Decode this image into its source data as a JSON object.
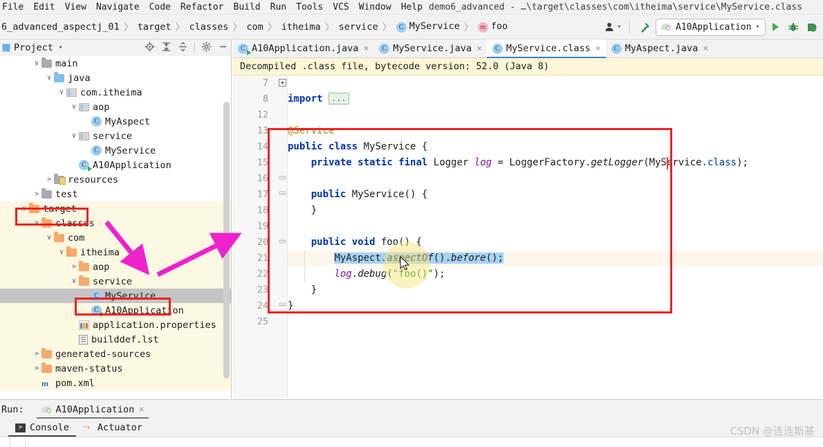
{
  "menu": {
    "items": [
      "File",
      "Edit",
      "View",
      "Navigate",
      "Code",
      "Refactor",
      "Build",
      "Run",
      "Tools",
      "VCS",
      "Window",
      "Help"
    ],
    "window_title": "demo6_advanced - …\\target\\classes\\com\\itheima\\service\\MyService.class"
  },
  "breadcrumb": {
    "items": [
      {
        "label": "6_advanced_aspectj_01",
        "icon": "none"
      },
      {
        "label": "target",
        "icon": "none"
      },
      {
        "label": "classes",
        "icon": "none"
      },
      {
        "label": "com",
        "icon": "none"
      },
      {
        "label": "itheima",
        "icon": "none"
      },
      {
        "label": "service",
        "icon": "none"
      },
      {
        "label": "MyService",
        "icon": "class-icon",
        "glyph": "C"
      },
      {
        "label": "foo",
        "icon": "method-icon",
        "glyph": "m"
      }
    ],
    "separator": "〉"
  },
  "toolbar": {
    "profile_icon": "user-silhouette-icon",
    "profile_caret": "▾",
    "build_icon": "hammer-icon",
    "run_config": {
      "label": "A10Application",
      "icon": "spring-boot-icon",
      "caret": "▾"
    },
    "run_icon": "run-play-icon",
    "debug_icon": "debug-bug-icon",
    "run_coverage_icon": "run-with-coverage-icon"
  },
  "sidebar": {
    "title": "Project",
    "title_caret": "▾",
    "header_icons": [
      "locate-target-icon",
      "expand-all-icon",
      "collapse-all-icon",
      "settings-gear-icon",
      "hide-minimize-icon"
    ],
    "tree": [
      {
        "label": "main",
        "depth": 2,
        "chev": "∨",
        "icon": "folder-gray",
        "highlight": "none",
        "selected": false
      },
      {
        "label": "java",
        "depth": 3,
        "chev": "∨",
        "icon": "folder-blue",
        "highlight": "none",
        "selected": false
      },
      {
        "label": "com.itheima",
        "depth": 4,
        "chev": "∨",
        "icon": "package",
        "highlight": "none",
        "selected": false
      },
      {
        "label": "aop",
        "depth": 5,
        "chev": "∨",
        "icon": "package",
        "highlight": "none",
        "selected": false
      },
      {
        "label": "MyAspect",
        "depth": 6,
        "chev": "",
        "icon": "class",
        "highlight": "none",
        "selected": false
      },
      {
        "label": "service",
        "depth": 5,
        "chev": "∨",
        "icon": "package",
        "highlight": "none",
        "selected": false
      },
      {
        "label": "MyService",
        "depth": 6,
        "chev": "",
        "icon": "class",
        "highlight": "none",
        "selected": false
      },
      {
        "label": "A10Application",
        "depth": 5,
        "chev": "",
        "icon": "class-run",
        "highlight": "none",
        "selected": false
      },
      {
        "label": "resources",
        "depth": 3,
        "chev": ">",
        "icon": "resource",
        "highlight": "none",
        "selected": false
      },
      {
        "label": "test",
        "depth": 2,
        "chev": ">",
        "icon": "folder-gray",
        "highlight": "none",
        "selected": false
      },
      {
        "label": "target",
        "depth": 1,
        "chev": "∨",
        "icon": "folder-orange",
        "highlight": "yellow",
        "selected": false
      },
      {
        "label": "classes",
        "depth": 2,
        "chev": "∨",
        "icon": "folder-orange",
        "highlight": "yellow",
        "selected": false
      },
      {
        "label": "com",
        "depth": 3,
        "chev": "∨",
        "icon": "folder-orange",
        "highlight": "yellow",
        "selected": false
      },
      {
        "label": "itheima",
        "depth": 4,
        "chev": "∨",
        "icon": "folder-orange",
        "highlight": "yellow",
        "selected": false
      },
      {
        "label": "aop",
        "depth": 5,
        "chev": ">",
        "icon": "folder-orange",
        "highlight": "yellow",
        "selected": false
      },
      {
        "label": "service",
        "depth": 5,
        "chev": "∨",
        "icon": "folder-orange",
        "highlight": "yellow",
        "selected": false
      },
      {
        "label": "MyService",
        "depth": 6,
        "chev": "",
        "icon": "class",
        "highlight": "none",
        "selected": true
      },
      {
        "label": "A10Application",
        "depth": 6,
        "chev": "",
        "icon": "class-run",
        "highlight": "yellow",
        "selected": false
      },
      {
        "label": "application.properties",
        "depth": 5,
        "chev": "",
        "icon": "properties",
        "highlight": "yellow",
        "selected": false
      },
      {
        "label": "builddef.lst",
        "depth": 5,
        "chev": "",
        "icon": "lst",
        "highlight": "yellow",
        "selected": false
      },
      {
        "label": "generated-sources",
        "depth": 2,
        "chev": ">",
        "icon": "folder-orange",
        "highlight": "yellow",
        "selected": false
      },
      {
        "label": "maven-status",
        "depth": 2,
        "chev": ">",
        "icon": "folder-orange",
        "highlight": "yellow",
        "selected": false
      },
      {
        "label": "pom.xml",
        "depth": 2,
        "chev": "",
        "icon": "xml",
        "highlight": "yellow",
        "selected": false
      }
    ]
  },
  "editor": {
    "tabs": [
      {
        "label": "A10Application.java",
        "icon": "class-run-icon",
        "active": false,
        "close": "×"
      },
      {
        "label": "MyService.java",
        "icon": "class-icon",
        "active": false,
        "close": "×"
      },
      {
        "label": "MyService.class",
        "icon": "class-icon",
        "active": true,
        "close": "×"
      },
      {
        "label": "MyAspect.java",
        "icon": "class-icon",
        "active": false,
        "close": "×"
      }
    ],
    "notice": "Decompiled .class file, bytecode version: 52.0 (Java 8)",
    "line_numbers": [
      "7",
      "8",
      "12",
      "13",
      "14",
      "15",
      "16",
      "17",
      "18",
      "19",
      "20",
      "21",
      "22",
      "23",
      "24",
      "25"
    ],
    "code_lines": [
      {
        "num": "7",
        "text": ""
      },
      {
        "num": "8",
        "text": "import ...",
        "kind": "import-fold"
      },
      {
        "num": "12",
        "text": ""
      },
      {
        "num": "13",
        "text": "@Service",
        "kind": "annotation"
      },
      {
        "num": "14",
        "text": "public class MyService {",
        "kind": "class-decl"
      },
      {
        "num": "15",
        "text": "    private static final Logger log = LoggerFactory.getLogger(MyService.class);",
        "kind": "field-decl"
      },
      {
        "num": "16",
        "text": ""
      },
      {
        "num": "17",
        "text": "    public MyService() {",
        "kind": "ctor"
      },
      {
        "num": "18",
        "text": "    }",
        "kind": "plain"
      },
      {
        "num": "19",
        "text": ""
      },
      {
        "num": "20",
        "text": "    public void foo() {",
        "kind": "method"
      },
      {
        "num": "21",
        "text": "        MyAspect.aspectOf().before();",
        "kind": "selected"
      },
      {
        "num": "22",
        "text": "        log.debug(\"foo()\");",
        "kind": "log"
      },
      {
        "num": "23",
        "text": "    }",
        "kind": "plain"
      },
      {
        "num": "24",
        "text": "}",
        "kind": "plain"
      },
      {
        "num": "25",
        "text": ""
      }
    ],
    "fold_placeholder": "..."
  },
  "run_panel": {
    "label": "Run:",
    "config_name": "A10Application",
    "config_icon": "spring-boot-icon",
    "close": "×",
    "subtabs": [
      {
        "label": "Console",
        "icon": "console-icon",
        "active": true
      },
      {
        "label": "Actuator",
        "icon": "actuator-icon",
        "active": false
      }
    ]
  },
  "annotations": {
    "red_boxes": [
      "target-folder-box",
      "myservice-class-node-box",
      "code-body-box"
    ],
    "arrows": [
      "arrow-to-target-classes",
      "arrow-to-code-editor"
    ],
    "cursor": "mouse-pointer"
  },
  "watermark": "CSDN @连连斯基",
  "colors": {
    "accent_blue": "#3a7fd5",
    "annotation_red": "#ee2222",
    "annotation_magenta": "#ee22cc",
    "highlight_yellow": "#fcf8e2",
    "notice_yellow": "#fdf6d8",
    "selection_blue": "#a6d2f4",
    "keyword_blue": "#0033b3",
    "string_green": "#067d17",
    "field_purple": "#871094"
  }
}
